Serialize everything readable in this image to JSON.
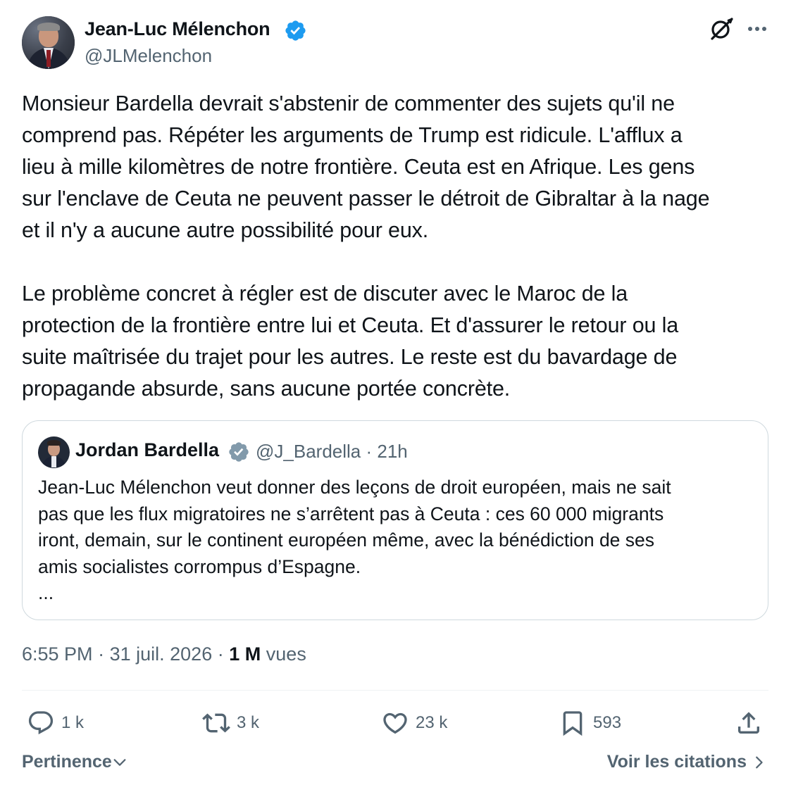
{
  "author": {
    "name": "Jean-Luc Mélenchon",
    "handle": "@JLMelenchon"
  },
  "tweet": {
    "lines": [
      "Monsieur Bardella devrait s'abstenir de commenter des sujets qu'il ne",
      "comprend pas. Répéter les arguments de Trump est ridicule. L'afflux a",
      "lieu à mille kilomètres de notre frontière. Ceuta est en Afrique. Les gens",
      "sur l'enclave de Ceuta ne peuvent passer le détroit de Gibraltar à la nage",
      "et il n'y a aucune autre possibilité pour eux.",
      "",
      "Le problème concret à régler est de discuter avec le Maroc de la",
      "protection de la frontière entre lui et Ceuta. Et d'assurer le retour ou la",
      "suite maîtrisée du trajet pour les autres. Le reste est du bavardage de",
      "propagande absurde, sans aucune portée concrète."
    ]
  },
  "quote": {
    "name": "Jordan Bardella",
    "handle": "@J_Bardella",
    "separator": "·",
    "time": "21h",
    "lines": [
      "Jean-Luc Mélenchon veut donner des leçons de droit européen, mais ne sait",
      "pas que les flux migratoires ne s’arrêtent pas à Ceuta : ces 60 000 migrants",
      "iront, demain, sur le continent européen même, avec la bénédiction de ses",
      "amis socialistes corrompus d’Espagne.",
      "..."
    ]
  },
  "meta": {
    "time": "6:55 PM",
    "date": "31 juil. 2026",
    "views_count": "1 M",
    "views_label": "vues",
    "separator": "·"
  },
  "actions": {
    "replies": "1 k",
    "reposts": "3 k",
    "likes": "23 k",
    "bookmarks": "593"
  },
  "footer": {
    "sort_label": "Pertinence",
    "quotes_link": "Voir les citations"
  },
  "icons": {
    "verified": "verified-badge-icon",
    "grok": "grok-icon",
    "more": "more-dots-icon",
    "reply": "reply-icon",
    "repost": "repost-icon",
    "like": "heart-icon",
    "bookmark": "bookmark-icon",
    "share": "share-icon"
  },
  "colors": {
    "verified": "#1d9bf0",
    "verified_gray": "#829aab",
    "secondary_text": "#536471",
    "primary_text": "#0f1419",
    "border": "#cfd9de"
  }
}
